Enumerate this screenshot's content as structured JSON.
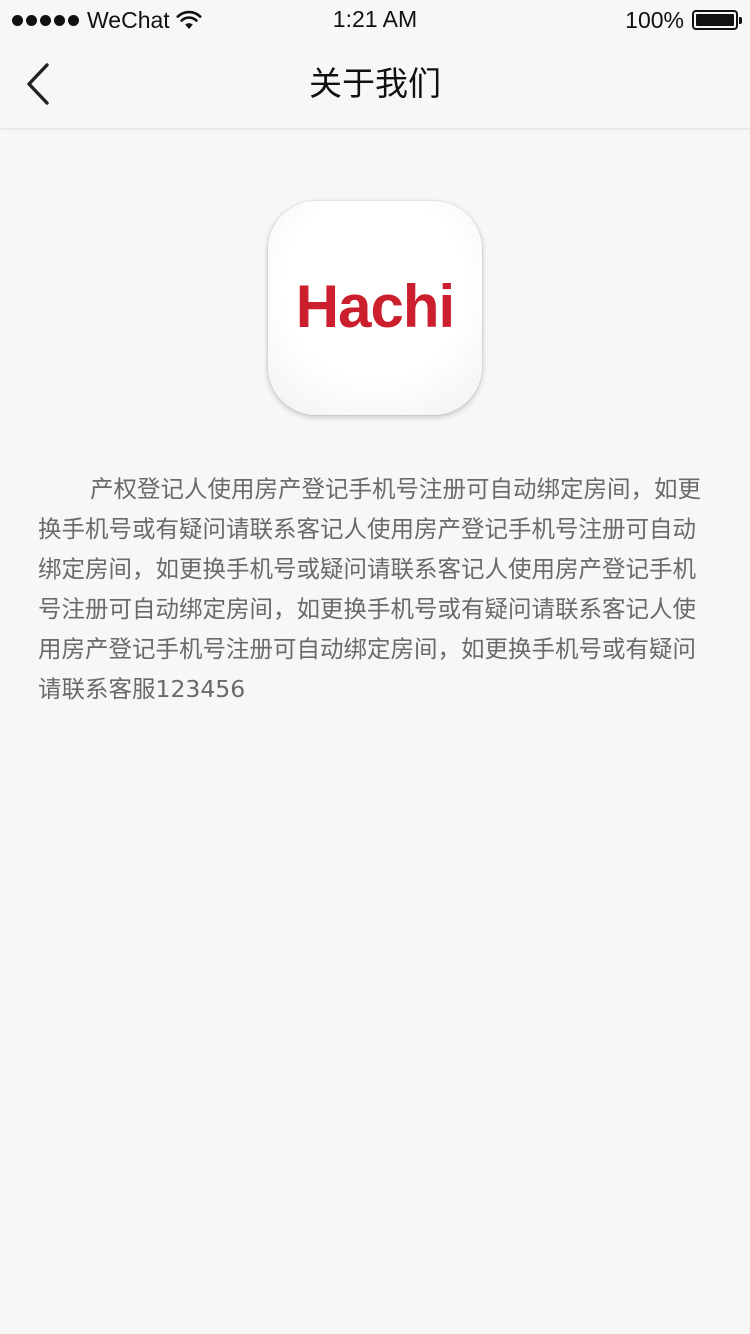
{
  "status_bar": {
    "carrier": "WeChat",
    "time": "1:21 AM",
    "battery_percent": "100%",
    "battery_level": 1.0,
    "signal_bars": 5,
    "icons": [
      "signal-dots-icon",
      "wifi-icon",
      "battery-icon"
    ]
  },
  "nav": {
    "title": "关于我们",
    "back_icon": "chevron-left-icon"
  },
  "logo": {
    "text": "Hachi",
    "color": "#cc1f2d"
  },
  "description": "产权登记人使用房产登记手机号注册可自动绑定房间，如更换手机号或有疑问请联系客记人使用房产登记手机号注册可自动绑定房间，如更换手机号或疑问请联系客记人使用房产登记手机号注册可自动绑定房间，如更换手机号或有疑问请联系客记人使用房产登记手机号注册可自动绑定房间，如更换手机号或有疑问请联系客服123456",
  "colors": {
    "background": "#f7f7f7",
    "text_primary": "#111111",
    "text_secondary": "#6a6a6a",
    "brand_red": "#cc1f2d"
  }
}
